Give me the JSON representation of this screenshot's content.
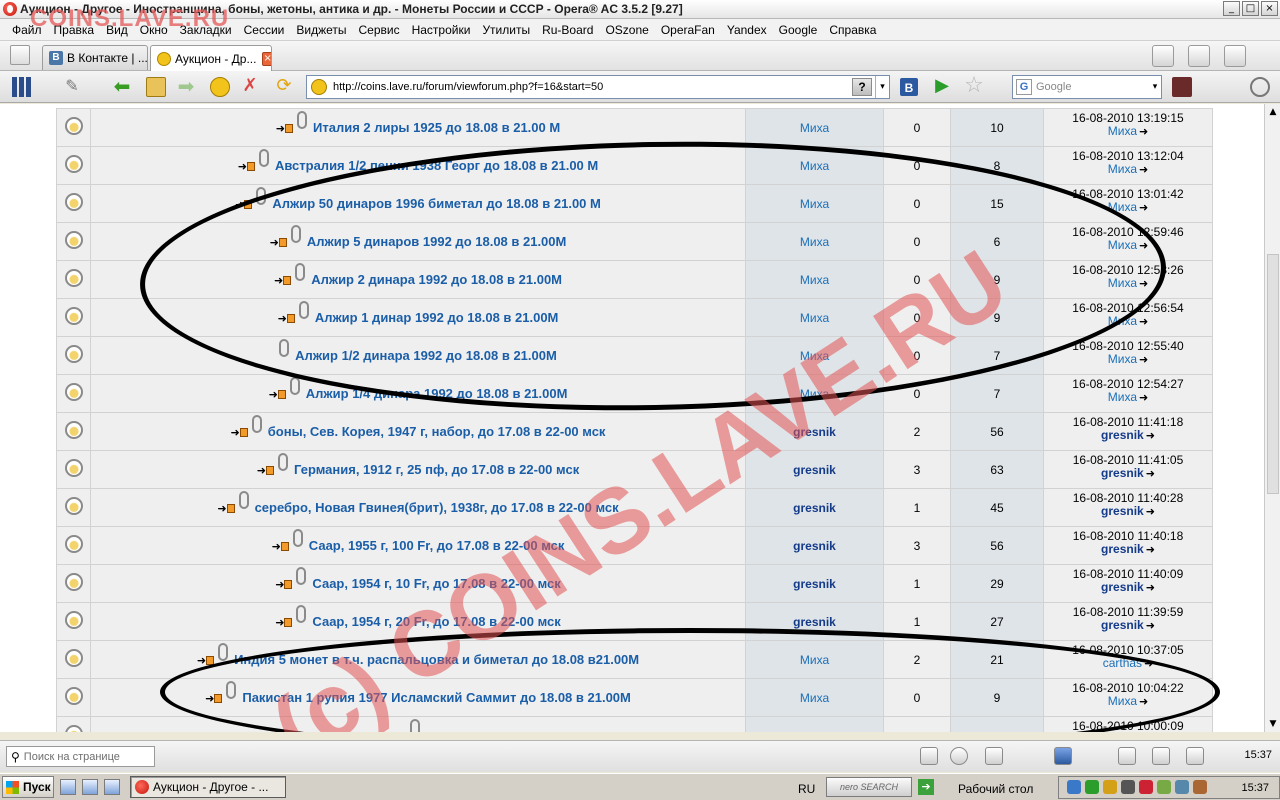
{
  "window": {
    "title": "Аукцион - Другое - Иностранщина, боны, жетоны, антика и др. - Монеты России и СССР - Opera® AC 3.5.2 [9.27]",
    "btn_min": "_",
    "btn_max": "□",
    "btn_close": "×"
  },
  "menu": [
    "Файл",
    "Правка",
    "Вид",
    "Окно",
    "Закладки",
    "Сессии",
    "Виджеты",
    "Сервис",
    "Настройки",
    "Утилиты",
    "Ru-Board",
    "OSzone",
    "OperaFan",
    "Yandex",
    "Google",
    "Справка"
  ],
  "tabs": [
    {
      "label": "В Контакте | ...",
      "icon": "vk-icon",
      "icon_glyph": "В",
      "active": false
    },
    {
      "label": "Аукцион - Др...",
      "icon": "smiley-icon",
      "active": true
    }
  ],
  "tab_close_glyph": "×",
  "address": {
    "url": "http://coins.lave.ru/forum/viewforum.php?f=16&start=50",
    "help_label": "?",
    "dropdown_glyph": "▾"
  },
  "toolbar": {
    "back_glyph": "⬅",
    "forward_glyph": "➡",
    "stop_glyph": "✗",
    "reload_glyph": "⟳",
    "pen_glyph": "✎",
    "blog_label": "B",
    "play_glyph": "▶",
    "star_glyph": "☆"
  },
  "search": {
    "engine_glyph": "G",
    "placeholder": "Google",
    "dropdown_glyph": "▾"
  },
  "topic_prefix": {
    "arrow": "➜"
  },
  "goto_glyph": "➜",
  "topics": [
    {
      "title": "Италия 2 лиры 1925 до 18.08 в 21.00 М",
      "author": "Миха",
      "author_bold": false,
      "replies": "0",
      "views": "10",
      "last_date": "16-08-2010 13:19:15",
      "last_author": "Миха",
      "prefix": true
    },
    {
      "title": "Австралия 1/2 пенни 1938 Георг до 18.08 в 21.00 М",
      "author": "Миха",
      "author_bold": false,
      "replies": "0",
      "views": "8",
      "last_date": "16-08-2010 13:12:04",
      "last_author": "Миха",
      "prefix": true
    },
    {
      "title": "Алжир 50 динаров 1996 биметал до 18.08 в 21.00 М",
      "author": "Миха",
      "author_bold": false,
      "replies": "0",
      "views": "15",
      "last_date": "16-08-2010 13:01:42",
      "last_author": "Миха",
      "prefix": true
    },
    {
      "title": "Алжир 5 динаров 1992 до 18.08 в 21.00М",
      "author": "Миха",
      "author_bold": false,
      "replies": "0",
      "views": "6",
      "last_date": "16-08-2010 12:59:46",
      "last_author": "Миха",
      "prefix": true
    },
    {
      "title": "Алжир 2 динара 1992 до 18.08 в 21.00М",
      "author": "Миха",
      "author_bold": false,
      "replies": "0",
      "views": "9",
      "last_date": "16-08-2010 12:58:26",
      "last_author": "Миха",
      "prefix": true
    },
    {
      "title": "Алжир 1 динар 1992 до 18.08 в 21.00М",
      "author": "Миха",
      "author_bold": false,
      "replies": "0",
      "views": "9",
      "last_date": "16-08-2010 12:56:54",
      "last_author": "Миха",
      "prefix": true
    },
    {
      "title": "Алжир 1/2 динара 1992 до 18.08 в 21.00М",
      "author": "Миха",
      "author_bold": false,
      "replies": "0",
      "views": "7",
      "last_date": "16-08-2010 12:55:40",
      "last_author": "Миха",
      "prefix": false
    },
    {
      "title": "Алжир 1/4 динара 1992 до 18.08 в 21.00М",
      "author": "Миха",
      "author_bold": false,
      "replies": "0",
      "views": "7",
      "last_date": "16-08-2010 12:54:27",
      "last_author": "Миха",
      "prefix": true
    },
    {
      "title": "боны, Сев. Корея, 1947 г, набор, до 17.08 в 22-00 мск",
      "author": "gresnik",
      "author_bold": true,
      "replies": "2",
      "views": "56",
      "last_date": "16-08-2010 11:41:18",
      "last_author": "gresnik",
      "prefix": true
    },
    {
      "title": "Германия, 1912 г, 25 пф, до 17.08 в 22-00 мск",
      "author": "gresnik",
      "author_bold": true,
      "replies": "3",
      "views": "63",
      "last_date": "16-08-2010 11:41:05",
      "last_author": "gresnik",
      "prefix": true
    },
    {
      "title": "серебро, Новая Гвинея(брит), 1938г, до 17.08 в 22-00 мск",
      "author": "gresnik",
      "author_bold": true,
      "replies": "1",
      "views": "45",
      "last_date": "16-08-2010 11:40:28",
      "last_author": "gresnik",
      "prefix": true
    },
    {
      "title": "Саар, 1955 г, 100 Fr, до 17.08 в 22-00 мск",
      "author": "gresnik",
      "author_bold": true,
      "replies": "3",
      "views": "56",
      "last_date": "16-08-2010 11:40:18",
      "last_author": "gresnik",
      "prefix": true
    },
    {
      "title": "Саар, 1954 г, 10 Fr, до 17.08 в 22-00 мск",
      "author": "gresnik",
      "author_bold": true,
      "replies": "1",
      "views": "29",
      "last_date": "16-08-2010 11:40:09",
      "last_author": "gresnik",
      "prefix": true
    },
    {
      "title": "Саар, 1954 г, 20 Fr, до 17.08 в 22-00 мск",
      "author": "gresnik",
      "author_bold": true,
      "replies": "1",
      "views": "27",
      "last_date": "16-08-2010 11:39:59",
      "last_author": "gresnik",
      "prefix": true
    },
    {
      "title": "Индия 5 монет в т.ч. распальцовка и биметал до 18.08 в21.00М",
      "author": "Миха",
      "author_bold": false,
      "replies": "2",
      "views": "21",
      "last_date": "16-08-2010 10:37:05",
      "last_author": "carthas",
      "prefix": true
    },
    {
      "title": "Пакистан 1 рупия 1977 Исламский Саммит до 18.08 в 21.00М",
      "author": "Миха",
      "author_bold": false,
      "replies": "0",
      "views": "9",
      "last_date": "16-08-2010 10:04:22",
      "last_author": "Миха",
      "prefix": true
    },
    {
      "title": "",
      "author": "",
      "author_bold": false,
      "replies": "",
      "views": "",
      "last_date": "16-08-2010 10:00:09",
      "last_author": "",
      "prefix": false
    }
  ],
  "watermarks": {
    "top_left": "COINS.LAVE.RU",
    "diagonal": "(c) COINS.LAVE.RU"
  },
  "scrollbar": {
    "up": "▲",
    "down": "▼"
  },
  "statusbar": {
    "find_icon": "⚲",
    "find_placeholder": "Поиск на странице",
    "time": "15:37"
  },
  "taskbar": {
    "start_label": "Пуск",
    "task_label": "Аукцион - Другое - ...",
    "lang": "RU",
    "nero_label": "nero SEARCH",
    "go_glyph": "➔",
    "desktop_label": "Рабочий стол",
    "clock": "15:37"
  },
  "colors": {
    "link": "#1b5ea8",
    "author_link": "#1b6fb8",
    "author_bold": "#143b8a",
    "watermark": "#e25454",
    "ellipse": "#000000"
  }
}
